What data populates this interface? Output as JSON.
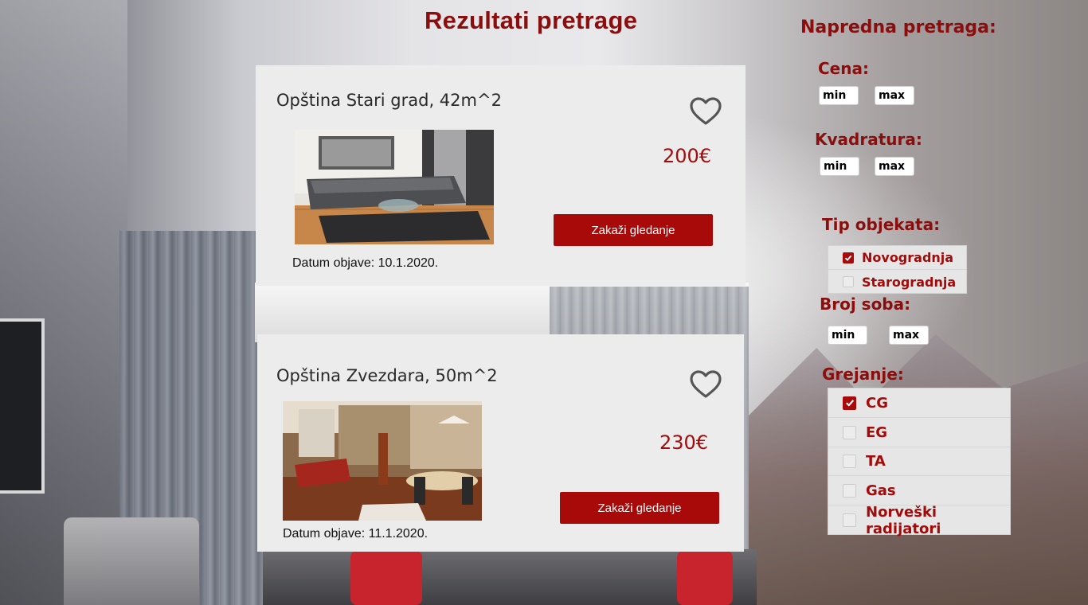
{
  "page": {
    "title": "Rezultati pretrage"
  },
  "listings": [
    {
      "heading": "Opština Stari grad, 42m^2",
      "price": "200€",
      "button_label": "Zakaži gledanje",
      "date": "Datum objave: 10.1.2020.",
      "favorite_icon": "heart-outline-icon"
    },
    {
      "heading": "Opština Zvezdara, 50m^2",
      "price": "230€",
      "button_label": "Zakaži gledanje",
      "date": "Datum objave: 11.1.2020.",
      "favorite_icon": "heart-outline-icon"
    }
  ],
  "filters": {
    "title": "Napredna pretraga:",
    "price": {
      "label": "Cena:",
      "min_placeholder": "min",
      "max_placeholder": "max"
    },
    "area": {
      "label": "Kvadratura:",
      "min_placeholder": "min",
      "max_placeholder": "max"
    },
    "property_type": {
      "label": "Tip objekata:",
      "options": [
        {
          "label": "Novogradnja",
          "checked": true
        },
        {
          "label": "Starogradnja",
          "checked": false
        }
      ]
    },
    "rooms": {
      "label": "Broj soba:",
      "min_placeholder": "min",
      "max_placeholder": "max"
    },
    "heating": {
      "label": "Grejanje:",
      "options": [
        {
          "label": "CG",
          "checked": true
        },
        {
          "label": "EG",
          "checked": false
        },
        {
          "label": "TA",
          "checked": false
        },
        {
          "label": "Gas",
          "checked": false
        },
        {
          "label": "Norveški radijatori",
          "checked": false
        }
      ]
    }
  },
  "colors": {
    "accent": "#a80a0a",
    "heading_red": "#8b0e0e",
    "card_bg": "#ececec"
  }
}
